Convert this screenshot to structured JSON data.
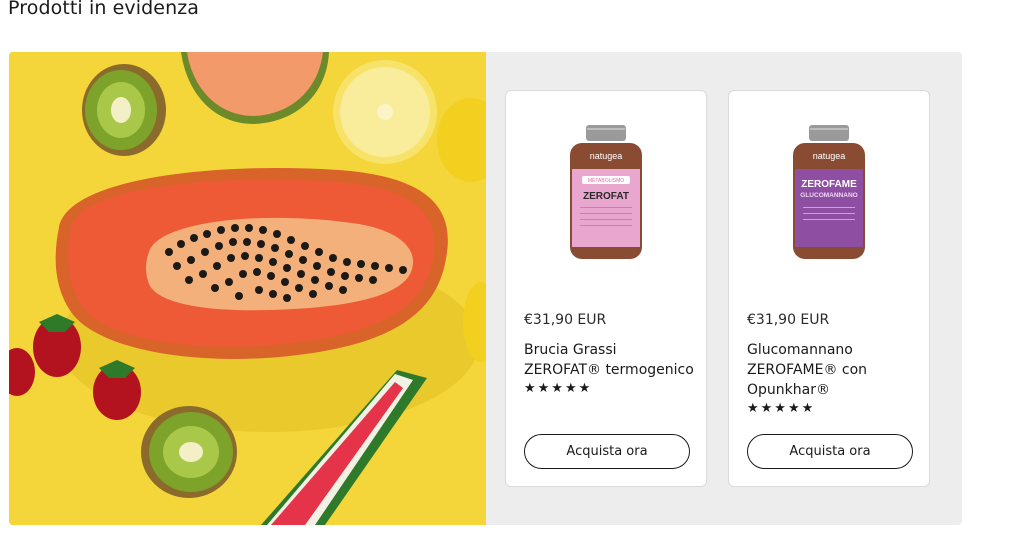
{
  "section": {
    "title": "Prodotti in evidenza"
  },
  "hero": {
    "image": "fruit-papaya-kiwi-watermelon-strawberry-lemon-image",
    "background": "#f4d63a"
  },
  "products": [
    {
      "brand": "natugea",
      "label_tag": "METABOLISMO",
      "label_name": "ZEROFAT",
      "label_color": "#e9a7cf",
      "price": "€31,90 EUR",
      "title": "Brucia Grassi ZEROFAT® termogenico",
      "rating_stars": "★★★★★",
      "rating": 5,
      "button_label": "Acquista ora"
    },
    {
      "brand": "natugea",
      "label_tag": "",
      "label_name": "ZEROFAME",
      "label_sub": "GLUCOMANNANO",
      "label_color": "#8e4fa3",
      "price": "€31,90 EUR",
      "title": "Glucomannano ZEROFAME® con Opunkhar®",
      "rating_stars": "★★★★★",
      "rating": 5,
      "button_label": "Acquista ora"
    }
  ]
}
